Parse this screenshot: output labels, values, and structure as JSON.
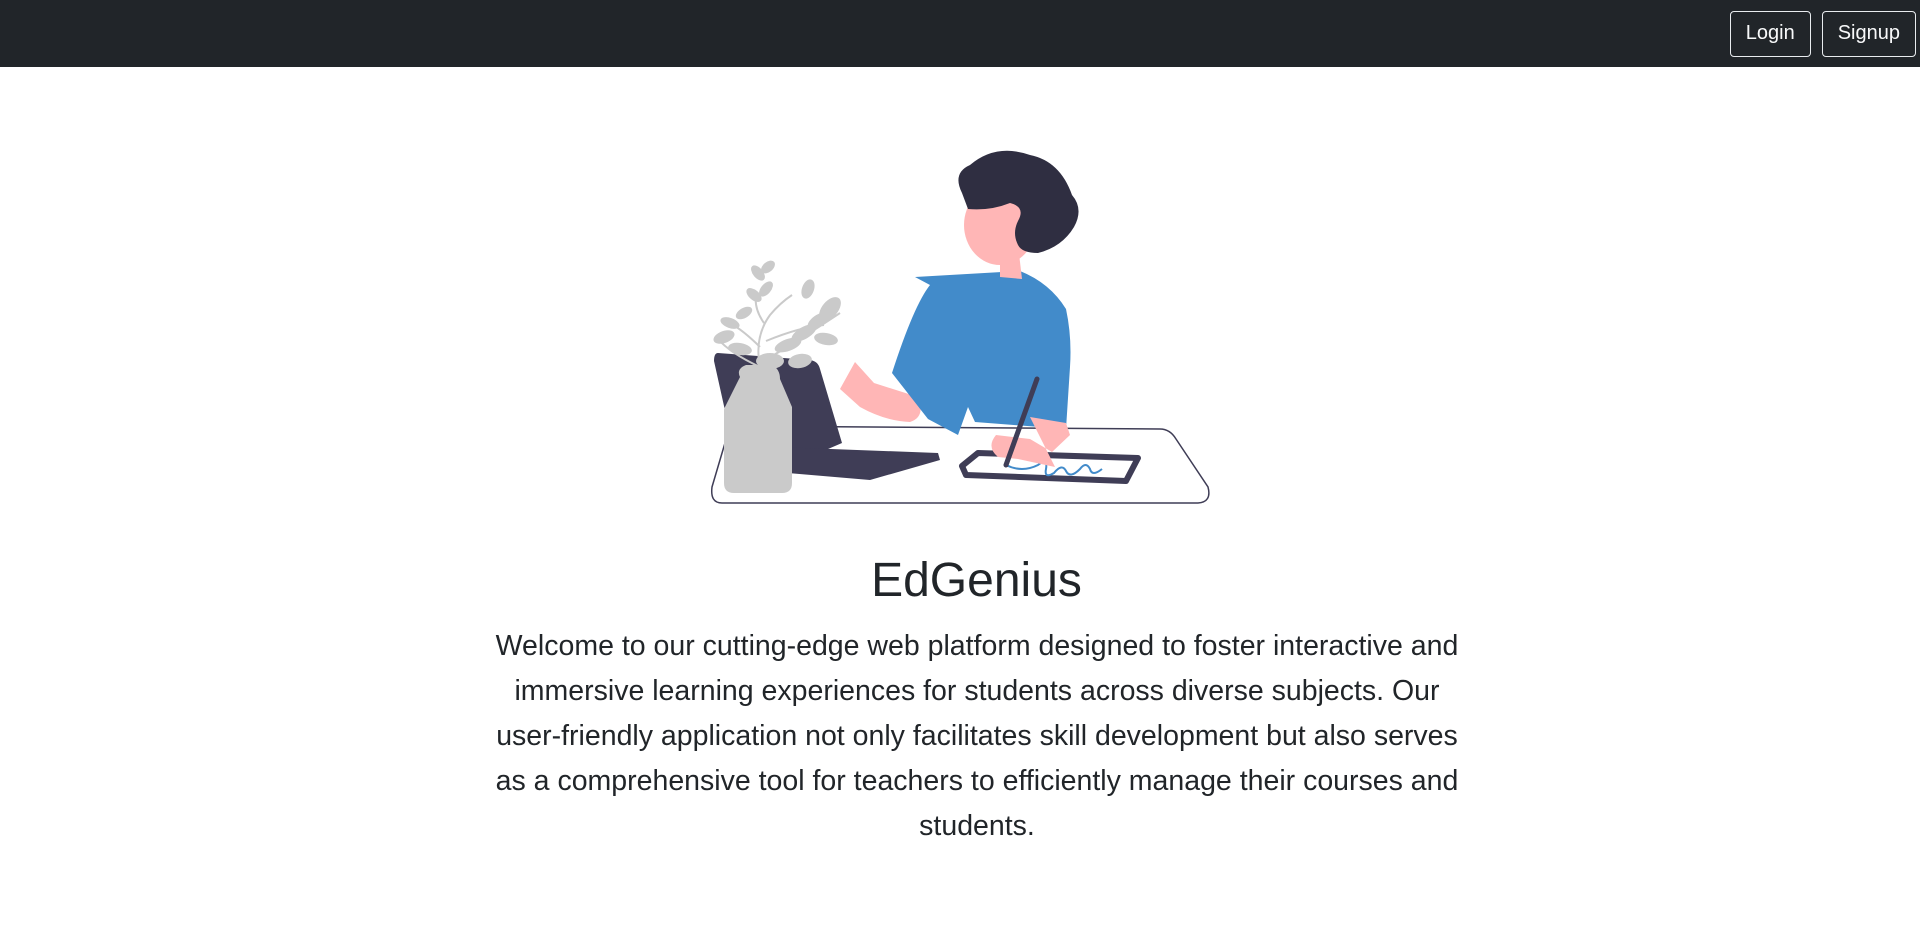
{
  "navbar": {
    "login_label": "Login",
    "signup_label": "Signup"
  },
  "hero": {
    "title": "EdGenius",
    "description": "Welcome to our cutting-edge web platform designed to foster interactive and immersive learning experiences for students across diverse subjects. Our user-friendly application not only facilitates skill development but also serves as a comprehensive tool for teachers to efficiently manage their courses and students.",
    "illustration": "person-studying-illustration"
  },
  "colors": {
    "navbar_bg": "#212529",
    "shirt": "#428bca",
    "hair": "#2f2e41",
    "skin": "#ffb6b6",
    "plant": "#cacaca",
    "laptop": "#3f3d56"
  }
}
